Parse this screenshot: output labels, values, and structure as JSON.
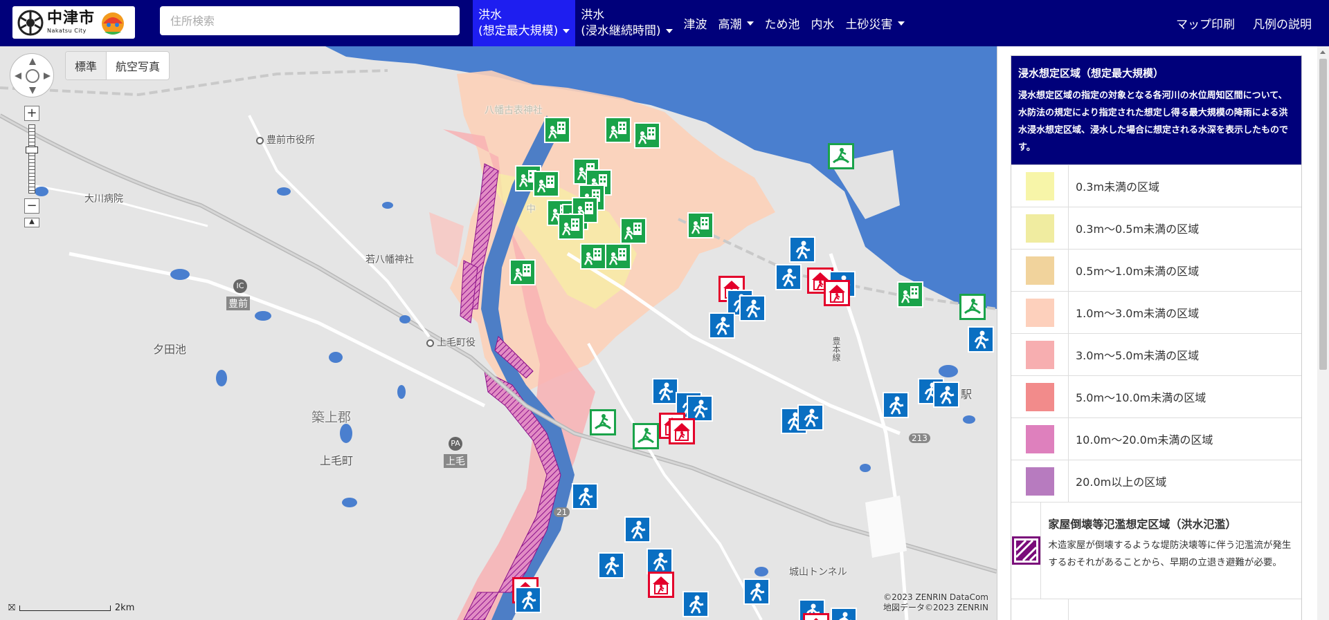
{
  "header": {
    "logo": {
      "name": "中津市",
      "sub": "Nakatsu City"
    },
    "search_placeholder": "住所検索",
    "nav": [
      {
        "line1": "洪水",
        "line2": "(想定最大規模)",
        "dropdown": true,
        "active": true
      },
      {
        "line1": "洪水",
        "line2": "(浸水継続時間)",
        "dropdown": true,
        "active": false
      },
      {
        "label": "津波",
        "dropdown": false
      },
      {
        "label": "高潮",
        "dropdown": true
      },
      {
        "label": "ため池",
        "dropdown": false
      },
      {
        "label": "内水",
        "dropdown": false
      },
      {
        "label": "土砂災害",
        "dropdown": true
      }
    ],
    "right": [
      "マップ印刷",
      "凡例の説明"
    ]
  },
  "map": {
    "tabs": [
      "標準",
      "航空写真"
    ],
    "labels": {
      "buzen_city_hall": "豊前市役所",
      "okawa_hospital": "大川病院",
      "wakahachiman": "若八幡神社",
      "ic": "IC",
      "buzen": "豊前",
      "yudaike": "夕田池",
      "kozuke_town_office": "上毛町役",
      "chikujo_gun": "築上郡",
      "pa": "PA",
      "kozuke_pa": "上毛",
      "kozuke_town": "上毛町",
      "hachimankoshi": "八幡古表神社",
      "naka": "中",
      "shiroyama_tunnel": "城山トンネル",
      "route_213": "213",
      "route_21": "21",
      "eki": "駅",
      "hohi_line": "豊本線"
    },
    "copyright": [
      "©2023 ZENRIN DataCom",
      "地図データ©2023 ZENRIN"
    ],
    "scale": "2km"
  },
  "legend": {
    "title": "浸水想定区域（想定最大規模）",
    "description": "浸水想定区域の指定の対象となる各河川の水位周知区間について、水防法の規定により指定された想定し得る最大規模の降雨による洪水浸水想定区域、浸水した場合に想定される水深を表示したものです。",
    "items": [
      {
        "label": "0.3m未満の区域",
        "color": "#f7f5a8"
      },
      {
        "label": "0.3m～0.5m未満の区域",
        "color": "#f0eca0"
      },
      {
        "label": "0.5m～1.0m未満の区域",
        "color": "#f1d39c"
      },
      {
        "label": "1.0m～3.0m未満の区域",
        "color": "#fdd0bc"
      },
      {
        "label": "3.0m～5.0m未満の区域",
        "color": "#f7aeb0"
      },
      {
        "label": "5.0m～10.0m未満の区域",
        "color": "#f28b8b"
      },
      {
        "label": "10.0m～20.0m未満の区域",
        "color": "#de80bd"
      },
      {
        "label": "20.0m以上の区域",
        "color": "#b77bbf"
      }
    ],
    "collapse": {
      "title": "家屋倒壊等氾濫想定区域（洪水氾濫）",
      "description": "木造家屋が倒壊するような堤防決壊等に伴う氾濫流が発生するおそれがあることから、早期の立退き避難が必要。",
      "color": "#7a0b7a"
    }
  }
}
